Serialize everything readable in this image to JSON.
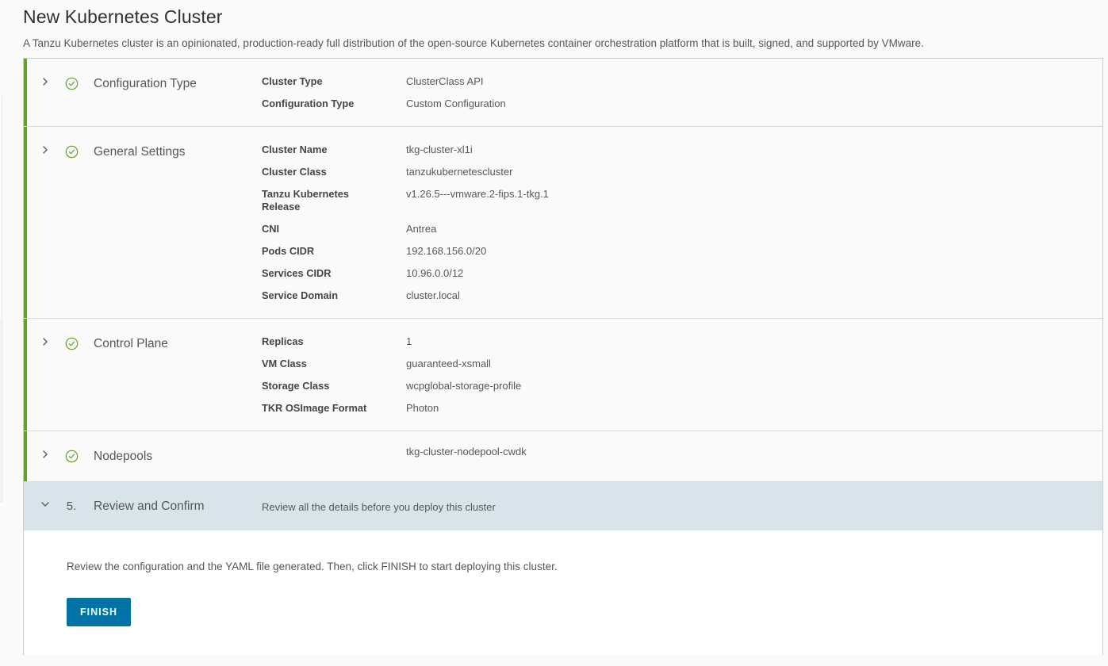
{
  "header": {
    "title": "New Kubernetes Cluster",
    "subtitle": "A Tanzu Kubernetes cluster is an opinionated, production-ready full distribution of the open-source Kubernetes container orchestration platform that is built, signed, and supported by VMware."
  },
  "colors": {
    "accent_complete": "#62a420",
    "active_step_bg": "#d9e4ea",
    "primary_button": "#0072a3"
  },
  "steps": [
    {
      "title": "Configuration Type",
      "state": "complete",
      "status_icon": "check-circle-icon",
      "chevron_icon": "chevron-right-icon",
      "number": "",
      "fields": [
        {
          "label": "Cluster Type",
          "value": "ClusterClass API"
        },
        {
          "label": "Configuration Type",
          "value": "Custom Configuration"
        }
      ]
    },
    {
      "title": "General Settings",
      "state": "complete",
      "status_icon": "check-circle-icon",
      "chevron_icon": "chevron-right-icon",
      "number": "",
      "fields": [
        {
          "label": "Cluster Name",
          "value": "tkg-cluster-xl1i"
        },
        {
          "label": "Cluster Class",
          "value": "tanzukubernetescluster"
        },
        {
          "label": "Tanzu Kubernetes Release",
          "value": "v1.26.5---vmware.2-fips.1-tkg.1"
        },
        {
          "label": "CNI",
          "value": "Antrea"
        },
        {
          "label": "Pods CIDR",
          "value": "192.168.156.0/20"
        },
        {
          "label": "Services CIDR",
          "value": "10.96.0.0/12"
        },
        {
          "label": "Service Domain",
          "value": "cluster.local"
        }
      ]
    },
    {
      "title": "Control Plane",
      "state": "complete",
      "status_icon": "check-circle-icon",
      "chevron_icon": "chevron-right-icon",
      "number": "",
      "fields": [
        {
          "label": "Replicas",
          "value": "1"
        },
        {
          "label": "VM Class",
          "value": "guaranteed-xsmall"
        },
        {
          "label": "Storage Class",
          "value": "wcpglobal-storage-profile"
        },
        {
          "label": "TKR OSImage Format",
          "value": "Photon"
        }
      ]
    },
    {
      "title": "Nodepools",
      "state": "complete",
      "status_icon": "check-circle-icon",
      "chevron_icon": "chevron-right-icon",
      "number": "",
      "summary": "tkg-cluster-nodepool-cwdk",
      "fields": []
    },
    {
      "title": "Review and Confirm",
      "state": "active",
      "status_icon": "",
      "chevron_icon": "chevron-down-icon",
      "number": "5.",
      "summary": "Review all the details before you deploy this cluster",
      "fields": []
    }
  ],
  "review_panel": {
    "instructions": "Review the configuration and the YAML file generated. Then, click FINISH to start deploying this cluster.",
    "finish_label": "FINISH"
  }
}
